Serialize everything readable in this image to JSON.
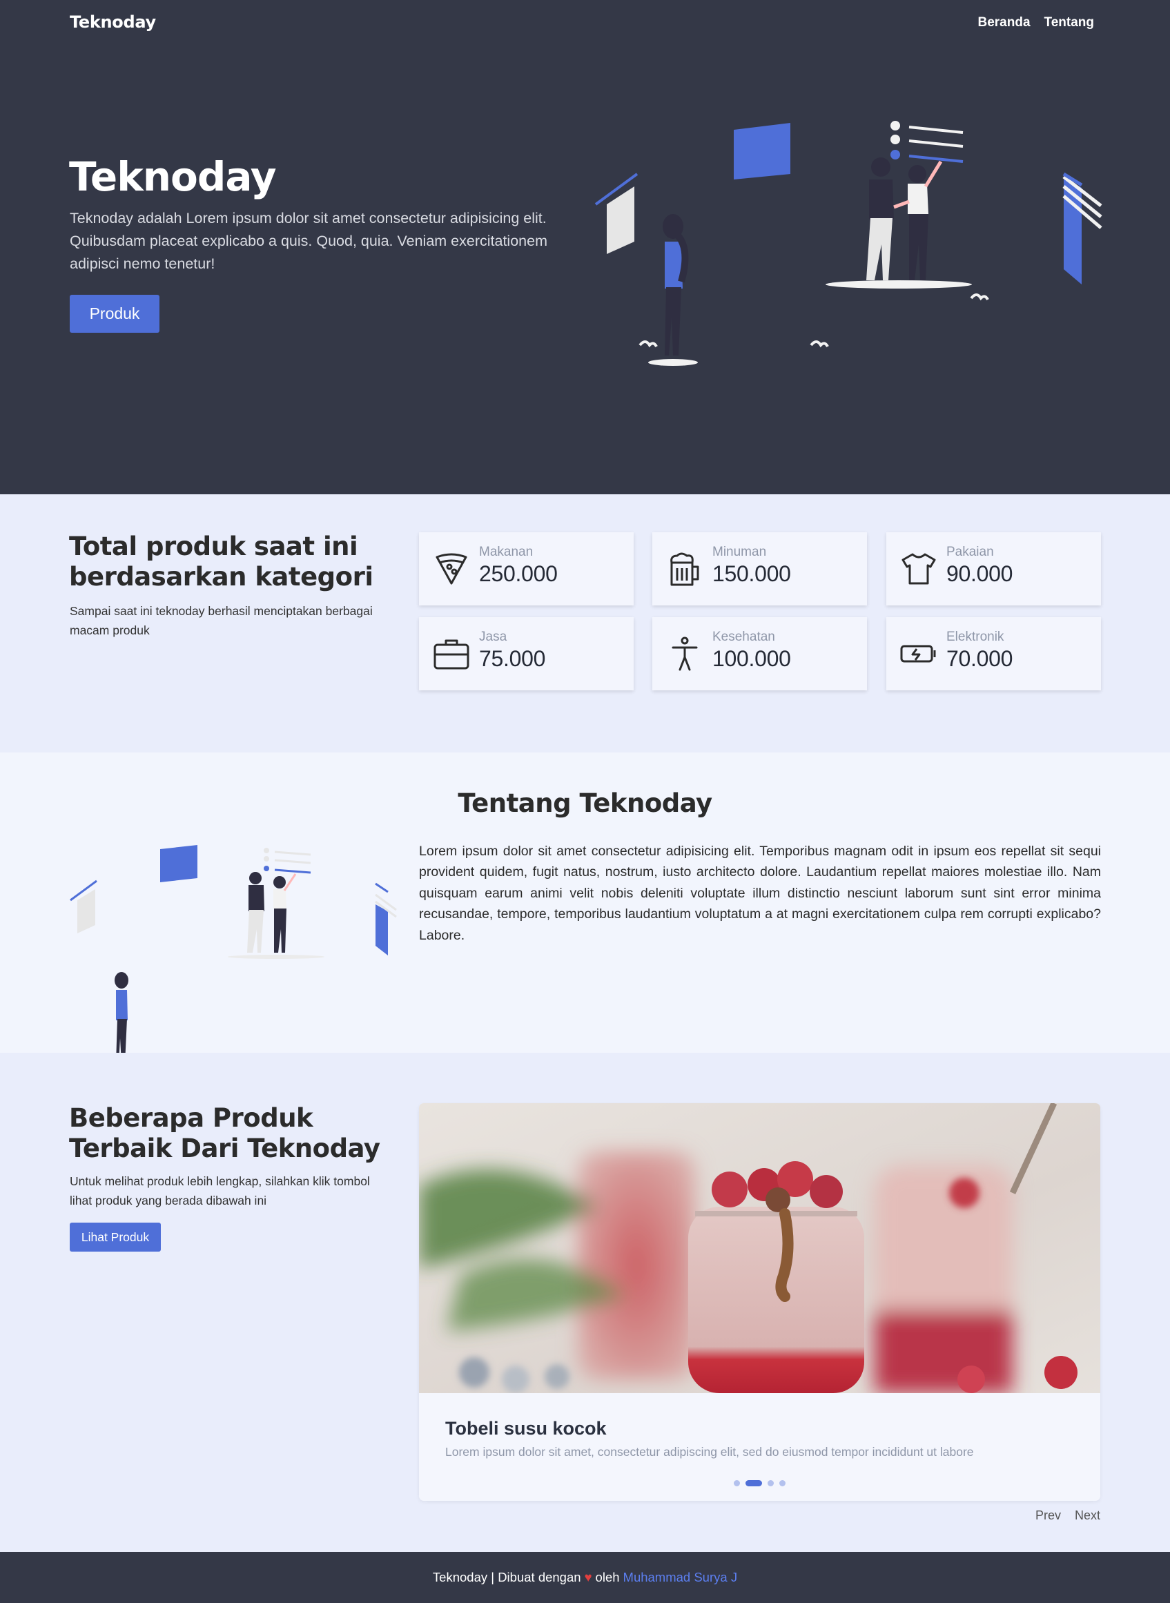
{
  "navbar": {
    "brand": "Teknoday",
    "links": [
      "Beranda",
      "Tentang"
    ]
  },
  "hero": {
    "title": "Teknoday",
    "text": "Teknoday adalah Lorem ipsum dolor sit amet consectetur adipisicing elit. Quibusdam placeat explicabo a quis. Quod, quia. Veniam exercitationem adipisci nemo tenetur!",
    "button": "Produk"
  },
  "stats": {
    "title": "Total produk saat ini berdasarkan kategori",
    "subtitle": "Sampai saat ini teknoday berhasil menciptakan berbagai macam produk",
    "cards": [
      {
        "label": "Makanan",
        "value": "250.000",
        "icon": "pizza-icon"
      },
      {
        "label": "Minuman",
        "value": "150.000",
        "icon": "beer-mug-icon"
      },
      {
        "label": "Pakaian",
        "value": "90.000",
        "icon": "tshirt-icon"
      },
      {
        "label": "Jasa",
        "value": "75.000",
        "icon": "briefcase-icon"
      },
      {
        "label": "Kesehatan",
        "value": "100.000",
        "icon": "accessibility-icon"
      },
      {
        "label": "Elektronik",
        "value": "70.000",
        "icon": "battery-charging-icon"
      }
    ]
  },
  "about": {
    "title": "Tentang Teknoday",
    "text": "Lorem ipsum dolor sit amet consectetur adipisicing elit. Temporibus magnam odit in ipsum eos repellat sit sequi provident quidem, fugit natus, nostrum, iusto architecto dolore. Laudantium repellat maiores molestiae illo. Nam quisquam earum animi velit nobis deleniti voluptate illum distinctio nesciunt laborum sunt sint error minima recusandae, tempore, temporibus laudantium voluptatum a at magni exercitationem culpa rem corrupti explicabo? Labore."
  },
  "products": {
    "title": "Beberapa Produk Terbaik Dari Teknoday",
    "subtitle": "Untuk melihat produk lebih lengkap, silahkan klik tombol lihat produk yang berada dibawah ini",
    "button": "Lihat Produk",
    "slide": {
      "title": "Tobeli susu kocok",
      "description": "Lorem ipsum dolor sit amet, consectetur adipiscing elit, sed do eiusmod tempor incididunt ut labore"
    },
    "slide_count": 4,
    "active_slide": 2,
    "prev": "Prev",
    "next": "Next"
  },
  "footer": {
    "text": "Teknoday | Dibuat dengan",
    "heart": "♥",
    "by": "oleh",
    "author": "Muhammad Surya J"
  },
  "colors": {
    "dark": "#343847",
    "accent": "#4f6fd8",
    "light_bg": "#e9edfb"
  }
}
